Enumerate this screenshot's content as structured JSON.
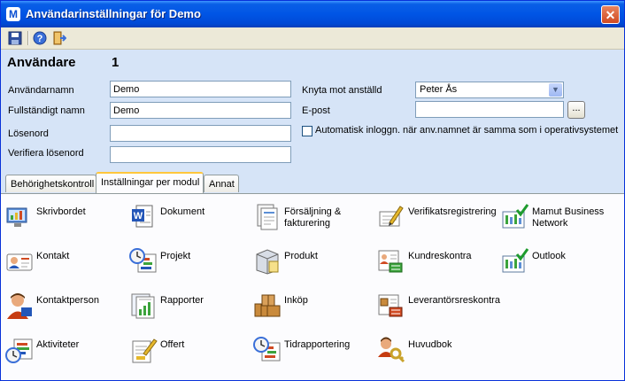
{
  "window": {
    "title": "Användarinställningar för Demo",
    "app_icon": "M",
    "close": "✕"
  },
  "toolbar": {
    "items": [
      "save-icon",
      "help-icon",
      "exit-icon"
    ]
  },
  "user": {
    "heading": "Användare",
    "number": "1",
    "username_label": "Användarnamn",
    "username_value": "Demo",
    "fullname_label": "Fullständigt namn",
    "fullname_value": "Demo",
    "password_label": "Lösenord",
    "password_value": "",
    "verify_label": "Verifiera lösenord",
    "verify_value": "",
    "employee_label": "Knyta mot anställd",
    "employee_value": "Peter Ås",
    "email_label": "E-post",
    "email_value": "",
    "email_button": "...",
    "autologin_label": "Automatisk inloggn. när anv.namnet är samma som i operativsystemet",
    "autologin_checked": false
  },
  "tabs": [
    {
      "label": "Behörighetskontroll",
      "active": false
    },
    {
      "label": "Inställningar per modul",
      "active": true
    },
    {
      "label": "Annat",
      "active": false
    }
  ],
  "modules": [
    {
      "label": "Skrivbordet",
      "icon": "desktop-icon"
    },
    {
      "label": "Dokument",
      "icon": "document-icon"
    },
    {
      "label": "Försäljning & fakturering",
      "icon": "sales-invoicing-icon"
    },
    {
      "label": "Verifikatsregistrering",
      "icon": "voucher-registration-icon"
    },
    {
      "label": "Mamut Business Network",
      "icon": "business-network-icon"
    },
    {
      "label": "Kontakt",
      "icon": "contact-icon"
    },
    {
      "label": "Projekt",
      "icon": "project-icon"
    },
    {
      "label": "Produkt",
      "icon": "product-icon"
    },
    {
      "label": "Kundreskontra",
      "icon": "accounts-receivable-icon"
    },
    {
      "label": "Outlook",
      "icon": "outlook-icon"
    },
    {
      "label": "Kontaktperson",
      "icon": "contact-person-icon"
    },
    {
      "label": "Rapporter",
      "icon": "reports-icon"
    },
    {
      "label": "Inköp",
      "icon": "purchase-icon"
    },
    {
      "label": "Leverantörsreskontra",
      "icon": "accounts-payable-icon"
    },
    {
      "label": "Aktiviteter",
      "icon": "activities-icon"
    },
    {
      "label": "Offert",
      "icon": "quote-icon"
    },
    {
      "label": "Tidrapportering",
      "icon": "time-reporting-icon"
    },
    {
      "label": "Huvudbok",
      "icon": "general-ledger-icon"
    }
  ]
}
